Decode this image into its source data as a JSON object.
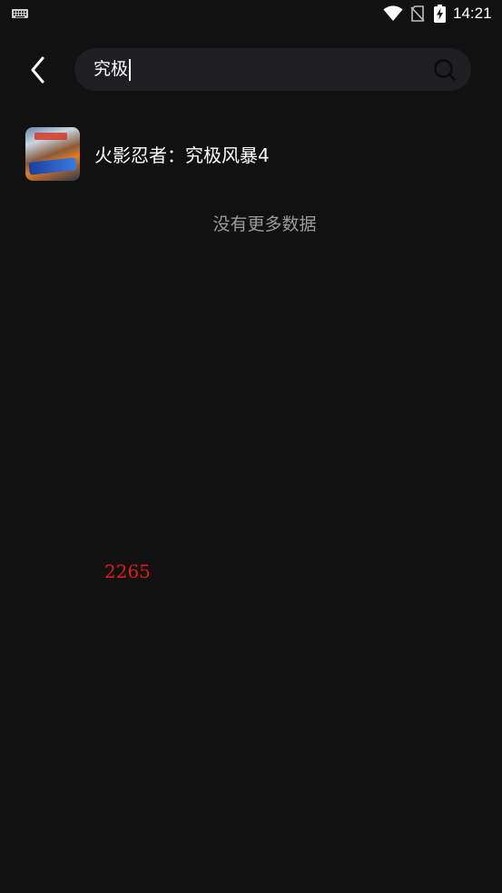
{
  "status_bar": {
    "time": "14:21",
    "icons": [
      "keyboard-icon",
      "wifi-icon",
      "no-sim-icon",
      "battery-charging-icon"
    ]
  },
  "header": {
    "back_icon": "chevron-left-icon",
    "search": {
      "value": "究极",
      "search_icon": "search-icon"
    }
  },
  "results": [
    {
      "title": "火影忍者：究极风暴4",
      "thumbnail": "game-cover"
    }
  ],
  "footer_text": "没有更多数据",
  "overlay_number": "2265",
  "colors": {
    "background": "#111112",
    "search_box": "#1f1f21",
    "muted_text": "#9a9a9a",
    "overlay_red": "#e11b1b"
  }
}
